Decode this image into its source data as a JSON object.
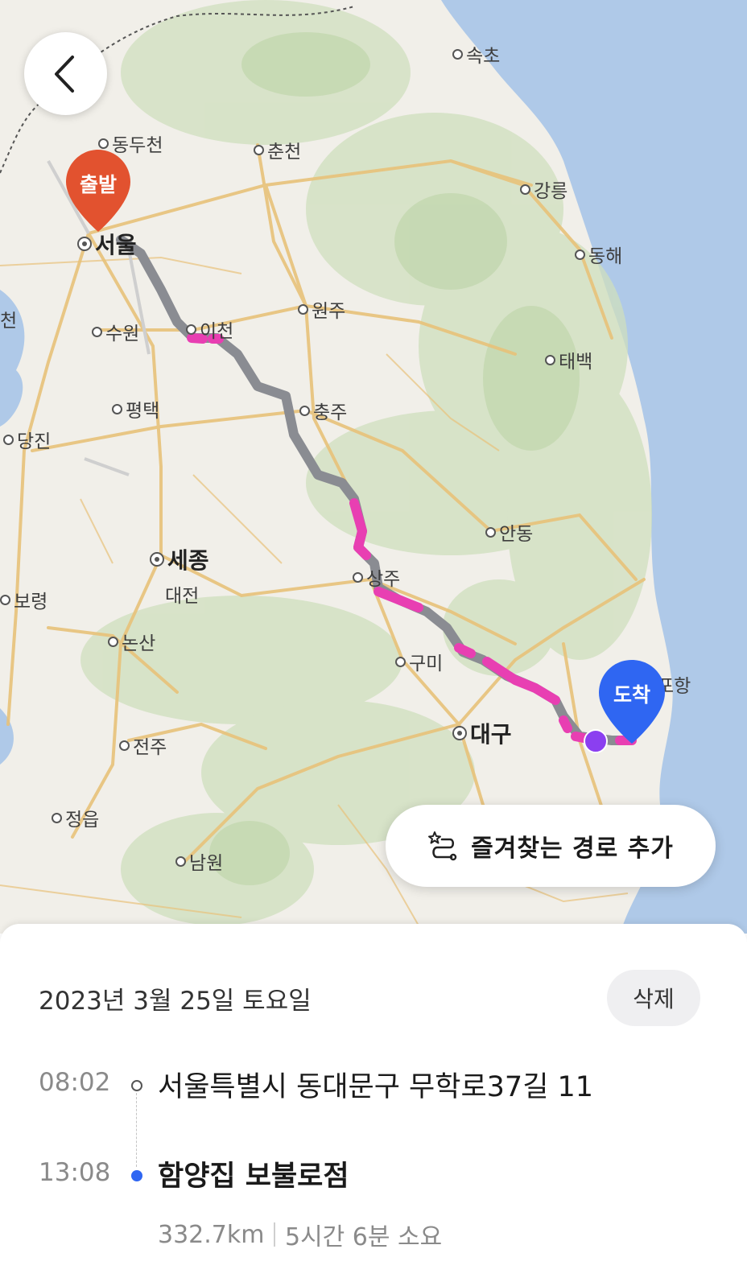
{
  "map": {
    "start_pin_label": "출발",
    "end_pin_label": "도착",
    "cities": {
      "sokcho": "속초",
      "dongducheon": "동두천",
      "chuncheon": "춘천",
      "gangneung": "강릉",
      "seoul": "서울",
      "donghae": "동해",
      "wonju": "원주",
      "suwon": "수원",
      "icheon": "이천",
      "taebaek": "태백",
      "pyeongtaek": "평택",
      "chungju": "충주",
      "dangjin": "당진",
      "andong": "안동",
      "sejong": "세종",
      "daejeon": "대전",
      "sangju": "상주",
      "boryeong": "보령",
      "nonsan": "논산",
      "gumi": "구미",
      "pohang": "포항",
      "daegu": "대구",
      "jeonju": "전주",
      "jeongeup": "정읍",
      "namwon": "남원",
      "edge_left": "천"
    },
    "colors": {
      "route_gray": "#8a8c92",
      "route_pink": "#e83fb2",
      "start_pin": "#e2522f",
      "end_pin": "#2f66f2",
      "current_position": "#8b3ff0"
    }
  },
  "back_button_icon": "chevron-left-icon",
  "favorite_route_button": {
    "label": "즐겨찾는 경로 추가",
    "icon": "route-star-icon"
  },
  "trip": {
    "date": "2023년 3월 25일 토요일",
    "delete_label": "삭제",
    "origin": {
      "time": "08:02",
      "address": "서울특별시 동대문구 무학로37길 11"
    },
    "destination": {
      "time": "13:08",
      "name": "함양집 보불로점"
    },
    "distance": "332.7km",
    "duration": "5시간 6분 소요"
  }
}
